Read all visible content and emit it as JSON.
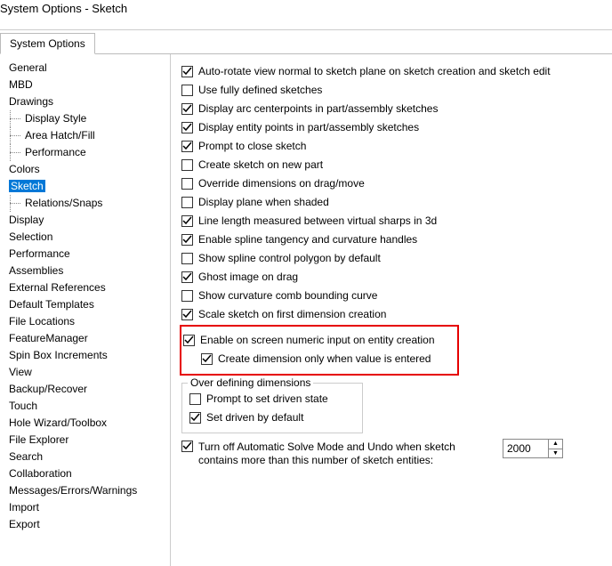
{
  "window_title": "System Options - Sketch",
  "tab_label": "System Options",
  "sidebar": [
    {
      "label": "General",
      "lvl": 0
    },
    {
      "label": "MBD",
      "lvl": 0
    },
    {
      "label": "Drawings",
      "lvl": 0
    },
    {
      "label": "Display Style",
      "lvl": 1
    },
    {
      "label": "Area Hatch/Fill",
      "lvl": 1
    },
    {
      "label": "Performance",
      "lvl": 1
    },
    {
      "label": "Colors",
      "lvl": 0
    },
    {
      "label": "Sketch",
      "lvl": 0,
      "selected": true
    },
    {
      "label": "Relations/Snaps",
      "lvl": 1
    },
    {
      "label": "Display",
      "lvl": 0
    },
    {
      "label": "Selection",
      "lvl": 0
    },
    {
      "label": "Performance",
      "lvl": 0
    },
    {
      "label": "Assemblies",
      "lvl": 0
    },
    {
      "label": "External References",
      "lvl": 0
    },
    {
      "label": "Default Templates",
      "lvl": 0
    },
    {
      "label": "File Locations",
      "lvl": 0
    },
    {
      "label": "FeatureManager",
      "lvl": 0
    },
    {
      "label": "Spin Box Increments",
      "lvl": 0
    },
    {
      "label": "View",
      "lvl": 0
    },
    {
      "label": "Backup/Recover",
      "lvl": 0
    },
    {
      "label": "Touch",
      "lvl": 0
    },
    {
      "label": "Hole Wizard/Toolbox",
      "lvl": 0
    },
    {
      "label": "File Explorer",
      "lvl": 0
    },
    {
      "label": "Search",
      "lvl": 0
    },
    {
      "label": "Collaboration",
      "lvl": 0
    },
    {
      "label": "Messages/Errors/Warnings",
      "lvl": 0
    },
    {
      "label": "Import",
      "lvl": 0
    },
    {
      "label": "Export",
      "lvl": 0
    }
  ],
  "options": [
    {
      "label": "Auto-rotate view normal to sketch plane on sketch creation and sketch edit",
      "checked": true
    },
    {
      "label": "Use fully defined sketches",
      "checked": false
    },
    {
      "label": "Display arc centerpoints in part/assembly sketches",
      "checked": true
    },
    {
      "label": "Display entity points in part/assembly sketches",
      "checked": true
    },
    {
      "label": "Prompt to close sketch",
      "checked": true
    },
    {
      "label": "Create sketch on new part",
      "checked": false
    },
    {
      "label": "Override dimensions on drag/move",
      "checked": false
    },
    {
      "label": "Display plane when shaded",
      "checked": false
    },
    {
      "label": "Line length measured between virtual sharps in 3d",
      "checked": true
    },
    {
      "label": "Enable spline tangency and curvature handles",
      "checked": true
    },
    {
      "label": "Show spline control polygon by default",
      "checked": false
    },
    {
      "label": "Ghost image on drag",
      "checked": true
    },
    {
      "label": "Show curvature comb bounding curve",
      "checked": false
    },
    {
      "label": "Scale sketch on first dimension creation",
      "checked": true
    }
  ],
  "highlighted": {
    "parent": {
      "label": "Enable on screen numeric input on entity creation",
      "checked": true
    },
    "child": {
      "label": "Create dimension only when value is entered",
      "checked": true
    }
  },
  "group": {
    "legend": "Over defining dimensions",
    "items": [
      {
        "label": "Prompt to set driven state",
        "checked": false
      },
      {
        "label": "Set driven by default",
        "checked": true
      }
    ]
  },
  "autosolve": {
    "label": "Turn off Automatic Solve Mode and Undo when sketch contains more than this number of sketch entities:",
    "checked": true,
    "value": "2000"
  }
}
